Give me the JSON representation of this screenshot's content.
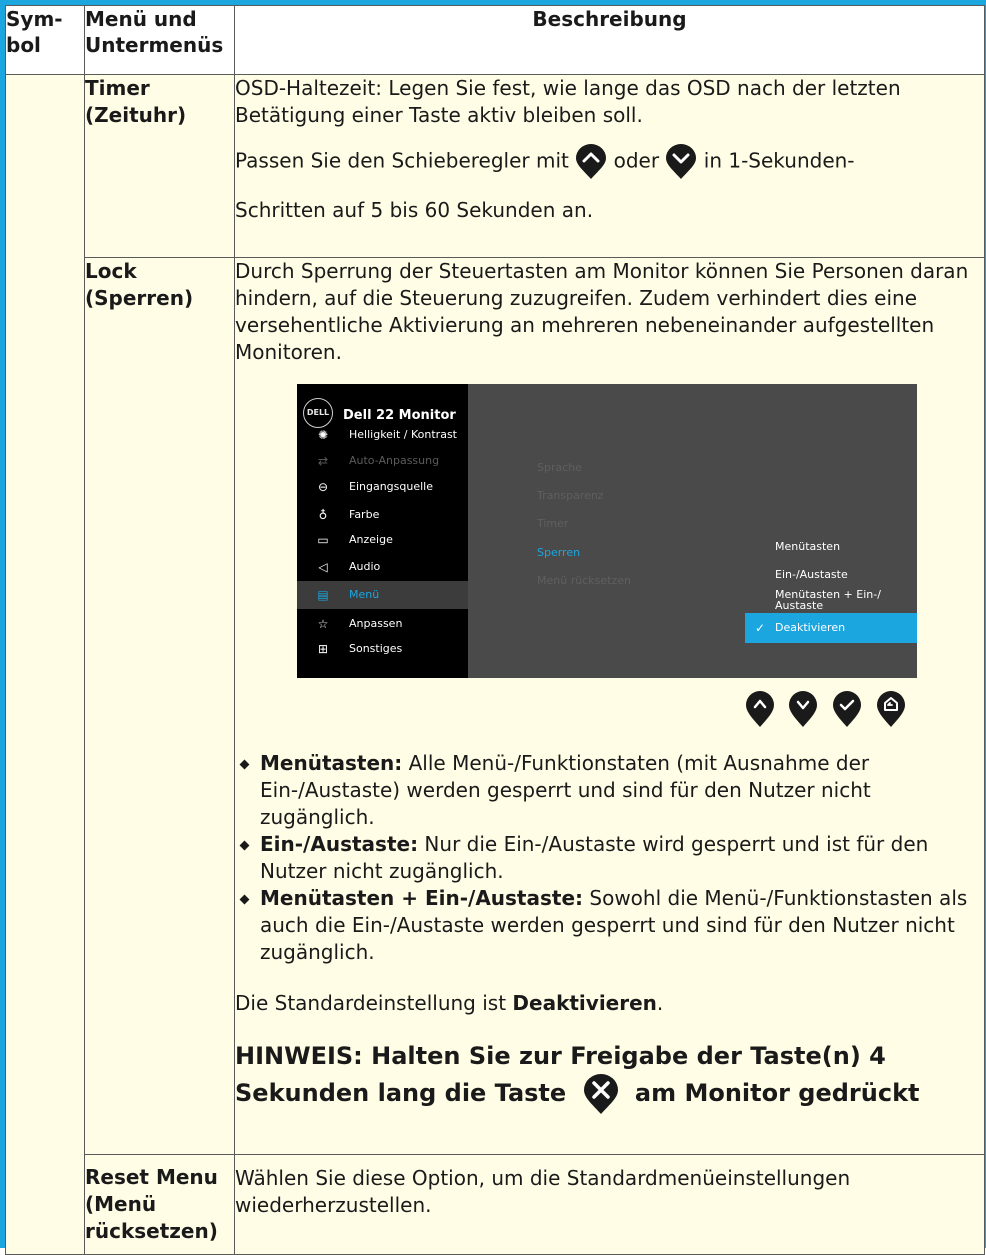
{
  "header": {
    "col_symbol": "Sym-\nbol",
    "col_menu": "Menü und\nUntermenüs",
    "col_desc": "Beschreibung"
  },
  "rows": {
    "timer": {
      "menu": "Timer\n(Zeituhr)",
      "p1": "OSD-Haltezeit: Legen Sie fest, wie lange das OSD nach der letzten Betätigung einer Taste aktiv bleiben soll.",
      "p2_before": "Passen Sie den Schieberegler mit ",
      "p2_mid": " oder ",
      "p2_after": " in 1-Sekunden-",
      "p3": "Schritten auf 5 bis 60 Sekunden an."
    },
    "lock": {
      "menu": "Lock\n(Sperren)",
      "intro": "Durch Sperrung der Steuertasten am Monitor können Sie Personen daran hindern, auf die Steuerung zuzugreifen. Zudem verhindert dies eine versehentliche Aktivierung an mehreren nebeneinander aufgestellten Monitoren.",
      "bullets": [
        {
          "term": "Menütasten:",
          "text": " Alle Menü-/Funktionstaten (mit Ausnahme der Ein-/Austaste) werden gesperrt und sind für den Nutzer nicht zugänglich."
        },
        {
          "term": "Ein-/Austaste:",
          "text": " Nur die Ein-/Austaste wird gesperrt und ist für den Nutzer nicht zugänglich."
        },
        {
          "term": "Menütasten + Ein-/Austaste:",
          "text": " Sowohl die Menü-/Funktionstasten als auch die Ein-/Austaste werden gesperrt und sind für den Nutzer nicht zugänglich."
        }
      ],
      "default_before": "Die Standardeinstellung ist ",
      "default_value": "Deaktivieren",
      "default_after": ".",
      "note_part1": "HINWEIS: Halten Sie zur Freigabe der Taste(n) 4 Sekunden lang die Taste ",
      "note_part2": " am Monitor gedrückt"
    },
    "reset": {
      "menu": "Reset Menu\n(Menü\nrücksetzen)",
      "desc": "Wählen Sie diese Option, um die Standardmenüeinstellungen wiederherzustellen."
    }
  },
  "osd": {
    "logo": "DELL",
    "title": "Dell 22 Monitor",
    "menu_items": [
      {
        "icon": "brightness-icon",
        "label": "Helligkeit / Kontrast",
        "state": "normal"
      },
      {
        "icon": "auto-adjust-icon",
        "label": "Auto-Anpassung",
        "state": "dim"
      },
      {
        "icon": "input-source-icon",
        "label": "Eingangsquelle",
        "state": "normal"
      },
      {
        "icon": "color-icon",
        "label": "Farbe",
        "state": "normal"
      },
      {
        "icon": "display-icon",
        "label": "Anzeige",
        "state": "normal"
      },
      {
        "icon": "audio-icon",
        "label": "Audio",
        "state": "normal"
      },
      {
        "icon": "menu-icon",
        "label": "Menü",
        "state": "selected"
      },
      {
        "icon": "star-icon",
        "label": "Anpassen",
        "state": "normal"
      },
      {
        "icon": "others-icon",
        "label": "Sonstiges",
        "state": "normal"
      }
    ],
    "submenu": [
      "Sprache",
      "Transparenz",
      "Timer",
      "Sperren",
      "Menü rücksetzen"
    ],
    "options": [
      "Menütasten",
      "Ein-/Austaste",
      "Menütasten + Ein-/\nAustaste",
      "Deaktivieren"
    ],
    "colors": {
      "accent": "#1ba6e0",
      "panel": "#4a4a4a",
      "left": "#000000"
    }
  }
}
